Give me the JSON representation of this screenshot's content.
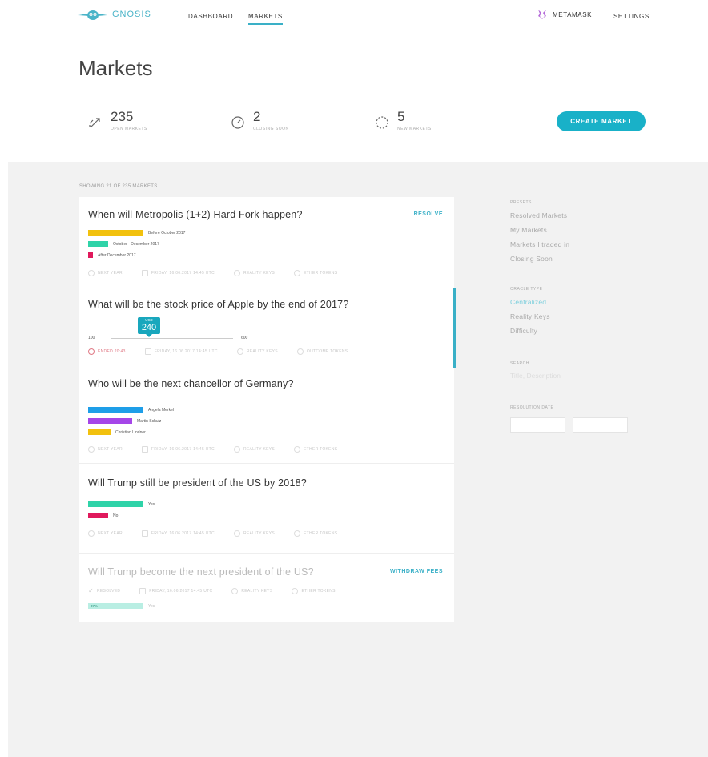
{
  "header": {
    "brand": "GNOSIS",
    "nav": {
      "dashboard": "DASHBOARD",
      "markets": "MARKETS"
    },
    "metamask": "METAMASK",
    "settings": "SETTINGS",
    "colors": {
      "accent": "#19b1c8",
      "brand": "#4bb4c8"
    }
  },
  "page": {
    "title": "Markets",
    "stats": [
      {
        "value": "235",
        "label": "OPEN MARKETS",
        "icon": "arrows-icon"
      },
      {
        "value": "2",
        "label": "CLOSING SOON",
        "icon": "clock-icon"
      },
      {
        "value": "5",
        "label": "NEW MARKETS",
        "icon": "spinner-icon"
      }
    ],
    "create_button": "CREATE MARKET"
  },
  "list": {
    "showing": "SHOWING 21 OF 235 MARKETS",
    "markets": [
      {
        "question": "When will Metropolis (1+2) Hard Fork happen?",
        "action": "RESOLVE",
        "outcomes": [
          {
            "label": "Before October 2017",
            "color": "#f2c10e",
            "share": 0.69
          },
          {
            "label": "October - December 2017",
            "color": "#2fd3a8",
            "share": 0.25
          },
          {
            "label": "After December 2017",
            "color": "#e0195c",
            "share": 0.06
          }
        ],
        "meta": [
          "NEXT YEAR",
          "FRIDAY, 16.06.2017 14:45 UTC",
          "REALITY KEYS",
          "ETHER TOKENS"
        ]
      },
      {
        "question": "What will be the stock price of Apple by the end of 2017?",
        "scalar": {
          "min": "100",
          "max": "600",
          "unit": "USD",
          "value": "240"
        },
        "meta": [
          "ENDED 20:43",
          "FRIDAY, 16.06.2017 14:45 UTC",
          "REALITY KEYS",
          "OUTCOME TOKENS"
        ]
      },
      {
        "question": "Who will be the next chancellor of Germany?",
        "outcomes": [
          {
            "label": "Angela Merkel",
            "color": "#1e9ee8",
            "share": 0.69
          },
          {
            "label": "Martin Schulz",
            "color": "#a546e8",
            "share": 0.55
          },
          {
            "label": "Christian Lindner",
            "color": "#f2c10e",
            "share": 0.28
          }
        ],
        "meta": [
          "NEXT YEAR",
          "FRIDAY, 16.06.2017 14:45 UTC",
          "REALITY KEYS",
          "ETHER TOKENS"
        ]
      },
      {
        "question": "Will Trump still be president of the US by 2018?",
        "outcomes": [
          {
            "label": "Yes",
            "color": "#2fd3a8",
            "share": 0.69
          },
          {
            "label": "No",
            "color": "#e0195c",
            "share": 0.25
          }
        ],
        "meta": [
          "NEXT YEAR",
          "FRIDAY, 16.06.2017 14:45 UTC",
          "REALITY KEYS",
          "ETHER TOKENS"
        ]
      },
      {
        "question": "Will Trump become the next president of the US?",
        "action": "WITHDRAW FEES",
        "resolved_outcome": {
          "label": "Yes",
          "percent": "37%",
          "color": "#b9eee3"
        },
        "meta": [
          "RESOLVED",
          "FRIDAY, 16.06.2017 14:45 UTC",
          "REALITY KEYS",
          "ETHER TOKENS"
        ]
      }
    ]
  },
  "filters": {
    "presets_heading": "PRESETS",
    "presets": [
      "Resolved Markets",
      "My Markets",
      "Markets I traded in",
      "Closing Soon"
    ],
    "oracle_heading": "ORACLE TYPE",
    "oracles": [
      "Centralized",
      "Reality Keys",
      "Difficulty"
    ],
    "search_heading": "SEARCH",
    "search_placeholder": "Title, Description",
    "resolution_heading": "RESOLUTION DATE"
  }
}
